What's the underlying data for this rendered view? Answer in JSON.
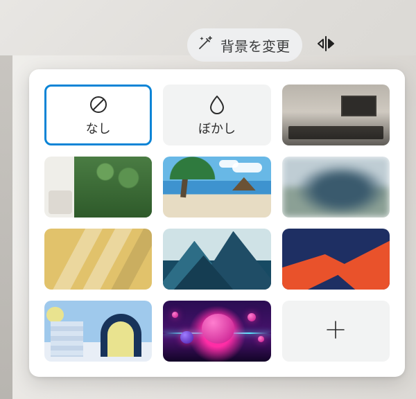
{
  "toolbar": {
    "change_bg_label": "背景を変更"
  },
  "panel": {
    "tiles": {
      "none_label": "なし",
      "blur_label": "ぼかし"
    }
  }
}
